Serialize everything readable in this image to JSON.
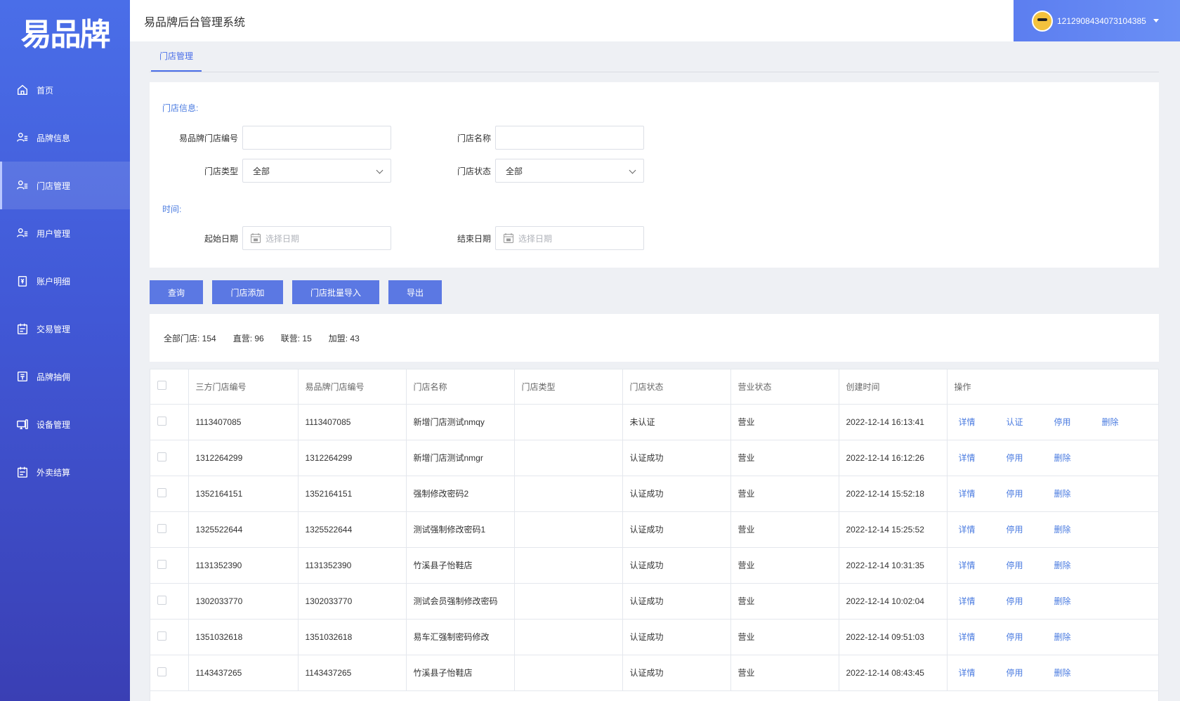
{
  "brand": {
    "logo_text": "易品牌",
    "system_title": "易品牌后台管理系统"
  },
  "user": {
    "name": "1212908434073104385"
  },
  "sidebar": {
    "items": [
      {
        "label": "首页",
        "icon": "home-icon"
      },
      {
        "label": "品牌信息",
        "icon": "brand-info-icon"
      },
      {
        "label": "门店管理",
        "icon": "store-icon",
        "active": true
      },
      {
        "label": "用户管理",
        "icon": "user-icon"
      },
      {
        "label": "账户明细",
        "icon": "account-icon"
      },
      {
        "label": "交易管理",
        "icon": "trade-icon"
      },
      {
        "label": "品牌抽佣",
        "icon": "commission-icon"
      },
      {
        "label": "设备管理",
        "icon": "device-icon"
      },
      {
        "label": "外卖结算",
        "icon": "settlement-icon"
      }
    ]
  },
  "tabs": [
    {
      "label": "门店管理"
    }
  ],
  "filters": {
    "store_info_label": "门店信息:",
    "time_label": "时间:",
    "store_no": {
      "label": "易品牌门店编号",
      "value": ""
    },
    "store_name": {
      "label": "门店名称",
      "value": ""
    },
    "store_type": {
      "label": "门店类型",
      "value": "全部"
    },
    "store_status": {
      "label": "门店状态",
      "value": "全部"
    },
    "start_date": {
      "label": "起始日期",
      "placeholder": "选择日期"
    },
    "end_date": {
      "label": "结束日期",
      "placeholder": "选择日期"
    }
  },
  "buttons": {
    "query": "查询",
    "add": "门店添加",
    "batch_import": "门店批量导入",
    "export": "导出"
  },
  "stats": {
    "all": "全部门店: 154",
    "direct": "直营: 96",
    "alliance": "联营: 15",
    "franchise": "加盟: 43"
  },
  "table": {
    "columns": [
      "三方门店编号",
      "易品牌门店编号",
      "门店名称",
      "门店类型",
      "门店状态",
      "营业状态",
      "创建时间",
      "操作"
    ],
    "rows": [
      {
        "third_no": "1113407085",
        "store_no": "1113407085",
        "name": "新增门店测试nmqy",
        "type": "",
        "status": "未认证",
        "business": "营业",
        "created": "2022-12-14 16:13:41",
        "ops": [
          "详情",
          "认证",
          "停用",
          "删除"
        ]
      },
      {
        "third_no": "1312264299",
        "store_no": "1312264299",
        "name": "新增门店测试nmgr",
        "type": "",
        "status": "认证成功",
        "business": "营业",
        "created": "2022-12-14 16:12:26",
        "ops": [
          "详情",
          "停用",
          "删除"
        ]
      },
      {
        "third_no": "1352164151",
        "store_no": "1352164151",
        "name": "强制修改密码2",
        "type": "",
        "status": "认证成功",
        "business": "营业",
        "created": "2022-12-14 15:52:18",
        "ops": [
          "详情",
          "停用",
          "删除"
        ]
      },
      {
        "third_no": "1325522644",
        "store_no": "1325522644",
        "name": "测试强制修改密码1",
        "type": "",
        "status": "认证成功",
        "business": "营业",
        "created": "2022-12-14 15:25:52",
        "ops": [
          "详情",
          "停用",
          "删除"
        ]
      },
      {
        "third_no": "1131352390",
        "store_no": "1131352390",
        "name": "竹溪县子怡鞋店",
        "type": "",
        "status": "认证成功",
        "business": "营业",
        "created": "2022-12-14 10:31:35",
        "ops": [
          "详情",
          "停用",
          "删除"
        ]
      },
      {
        "third_no": "1302033770",
        "store_no": "1302033770",
        "name": "测试会员强制修改密码",
        "type": "",
        "status": "认证成功",
        "business": "营业",
        "created": "2022-12-14 10:02:04",
        "ops": [
          "详情",
          "停用",
          "删除"
        ]
      },
      {
        "third_no": "1351032618",
        "store_no": "1351032618",
        "name": "易车汇强制密码修改",
        "type": "",
        "status": "认证成功",
        "business": "营业",
        "created": "2022-12-14 09:51:03",
        "ops": [
          "详情",
          "停用",
          "删除"
        ]
      },
      {
        "third_no": "1143437265",
        "store_no": "1143437265",
        "name": "竹溪县子怡鞋店",
        "type": "",
        "status": "认证成功",
        "business": "营业",
        "created": "2022-12-14 08:43:45",
        "ops": [
          "详情",
          "停用",
          "删除"
        ]
      }
    ]
  },
  "colors": {
    "primary": "#5b78e3",
    "link": "#4a7be0",
    "sidebar_top": "#4a6ee8",
    "sidebar_bottom": "#3a3fb4"
  }
}
